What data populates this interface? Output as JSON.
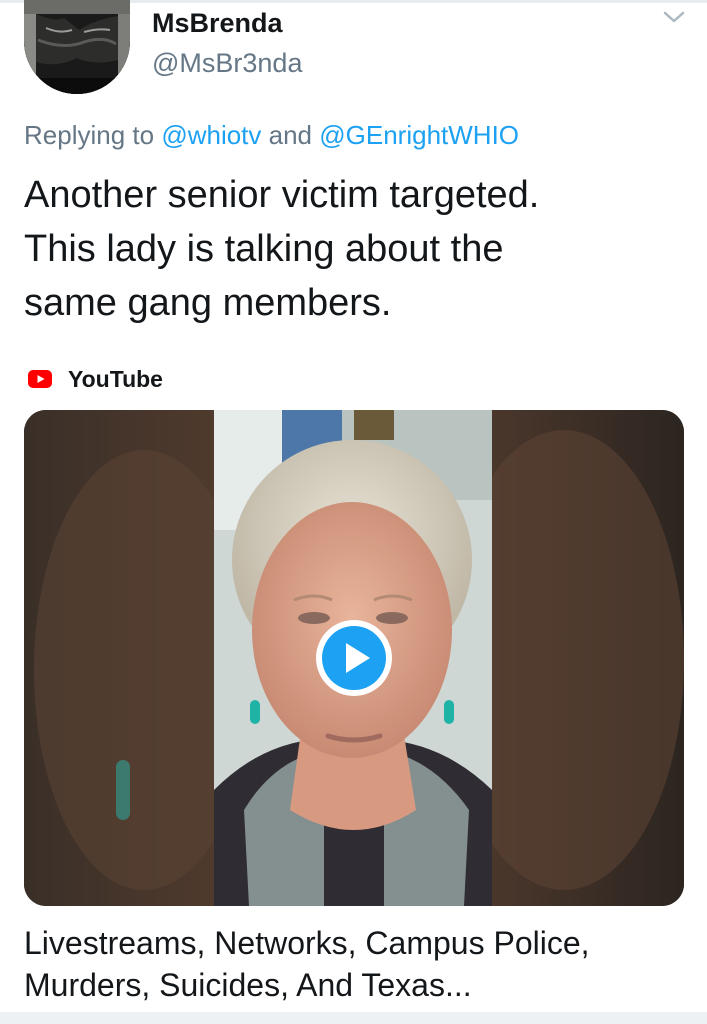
{
  "tweet": {
    "author": {
      "display_name": "MsBrenda",
      "handle": "@MsBr3nda",
      "avatar_icon": "avatar-photo"
    },
    "menu_icon": "chevron-down-icon",
    "replying": {
      "prefix": "Replying to",
      "mention_1": "@whiotv",
      "joiner": "and",
      "mention_2": "@GEnrightWHIO"
    },
    "text_lines": [
      "Another senior victim targeted.",
      "This lady is talking about the",
      "same gang members."
    ]
  },
  "card": {
    "source_icon": "youtube-icon",
    "source_label": "YouTube",
    "play_icon": "play-icon",
    "title_lines": [
      "Livestreams, Networks, Campus Police,",
      "Murders, Suicides, And Texas..."
    ]
  },
  "colors": {
    "link": "#1da1f2",
    "secondary_text": "#657786",
    "primary_text": "#14171a",
    "youtube_red": "#ff0000"
  }
}
